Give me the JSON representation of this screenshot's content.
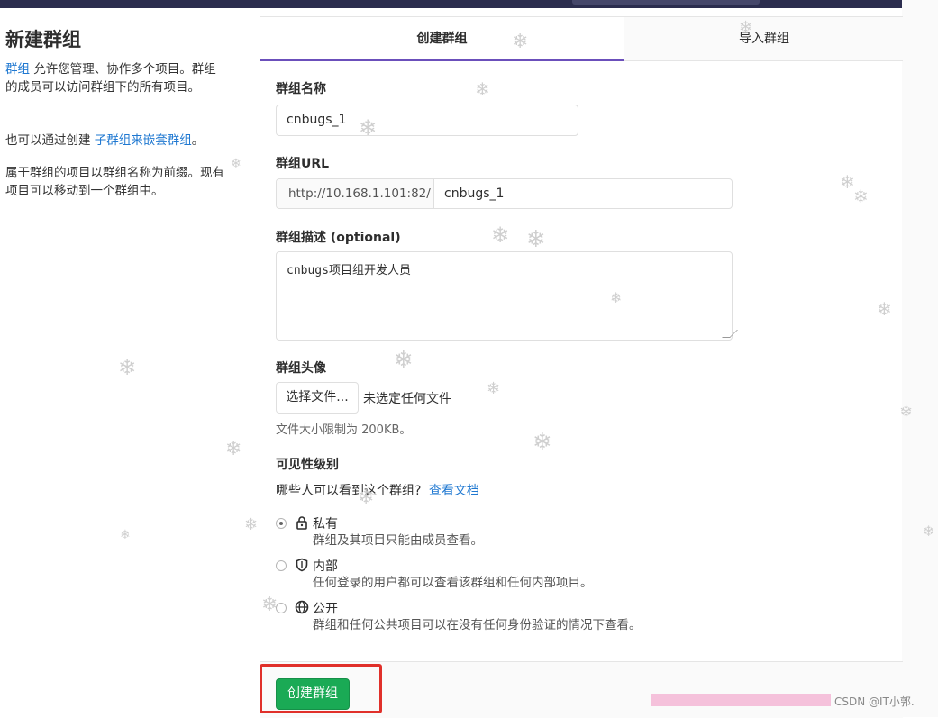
{
  "sidebar": {
    "title": "新建群组",
    "p1_link": "群组",
    "p1_text": " 允许您管理、协作多个项目。群组的成员可以访问群组下的所有项目。",
    "p2_text": "也可以通过创建 ",
    "p2_link": "子群组来嵌套群组",
    "p2_end": "。",
    "p3_text": "属于群组的项目以群组名称为前缀。现有项目可以移动到一个群组中。"
  },
  "tabs": {
    "create": "创建群组",
    "import": "导入群组"
  },
  "form": {
    "name_label": "群组名称",
    "name_value": "cnbugs_1",
    "url_label": "群组URL",
    "url_prefix": "http://10.168.1.101:82/",
    "url_path": "cnbugs_1",
    "desc_label": "群组描述 (optional)",
    "desc_value": "cnbugs项目组开发人员",
    "avatar_label": "群组头像",
    "file_button": "选择文件...",
    "file_none": "未选定任何文件",
    "file_hint": "文件大小限制为 200KB。",
    "visibility_label": "可见性级别",
    "visibility_question": "哪些人可以看到这个群组?",
    "visibility_doc_link": "查看文档",
    "visibility_options": [
      {
        "title": "私有",
        "desc": "群组及其项目只能由成员查看。",
        "icon": "lock-icon",
        "checked": true
      },
      {
        "title": "内部",
        "desc": "任何登录的用户都可以查看该群组和任何内部项目。",
        "icon": "shield-icon",
        "checked": false
      },
      {
        "title": "公开",
        "desc": "群组和任何公共项目可以在没有任何身份验证的情况下查看。",
        "icon": "globe-icon",
        "checked": false
      }
    ],
    "submit": "创建群组"
  },
  "watermark": "CSDN @IT小郭.",
  "colors": {
    "topbar": "#2b2d4e",
    "link": "#1f78d1",
    "tab_active_border": "#6b4fbb",
    "submit_bg": "#1aaa55",
    "highlight": "#e0302a"
  }
}
